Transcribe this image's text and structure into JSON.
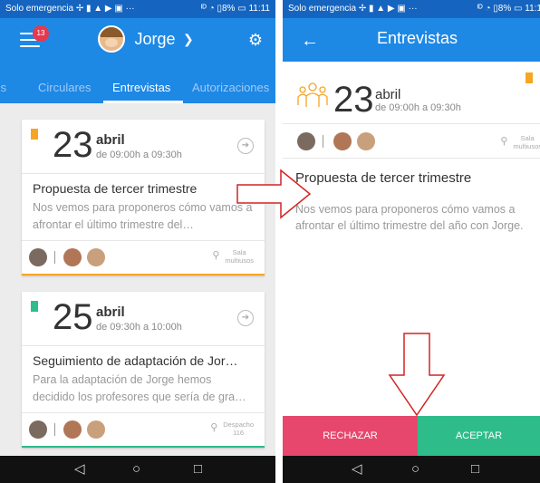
{
  "left": {
    "status": {
      "left": "Solo emergencia ✢ ▮ ▲ ▶ ▣ ···",
      "right": "ᴵᴰ ◔ ▯8% ▭ 11:11"
    },
    "header": {
      "badge": "13",
      "user": "Jorge"
    },
    "tabs": [
      "ss",
      "Circulares",
      "Entrevistas",
      "Autorizaciones"
    ],
    "cards": [
      {
        "day": "23",
        "month": "abril",
        "time": "de 09:00h a 09:30h",
        "title": "Propuesta de tercer trimestre",
        "desc": "Nos vemos para proponeros cómo vamos a afrontar el último trimestre del…",
        "room": [
          "Sala",
          "multiusos"
        ],
        "flag_color": "#f5a623",
        "line_color": "#f5a623"
      },
      {
        "day": "25",
        "month": "abril",
        "time": "de 09:30h a 10:00h",
        "title": "Seguimiento  de adaptación de Jor…",
        "desc": "Para la adaptación de Jorge hemos decidido los profesores que sería de gra…",
        "room": [
          "Despacho",
          "116"
        ],
        "flag_color": "#2ebd8a",
        "line_color": "#2ebd8a"
      }
    ]
  },
  "right": {
    "status": {
      "left": "Solo emergencia ✢ ▮ ▲ ▶ ▣ ···",
      "right": "ᴵᴰ ◔ ▯8% ▭ 11:1"
    },
    "title": "Entrevistas",
    "detail": {
      "day": "23",
      "month": "abril",
      "time": "de 09:00h a 09:30h",
      "room": [
        "Sala",
        "multiusos"
      ],
      "title": "Propuesta de tercer trimestre",
      "desc": "Nos vemos para proponeros cómo vamos a afrontar el último trimestre del año con Jorge."
    },
    "actions": {
      "reject": "RECHAZAR",
      "accept": "ACEPTAR"
    }
  },
  "nav": {
    "back": "◁",
    "home": "○",
    "recent": "□"
  }
}
